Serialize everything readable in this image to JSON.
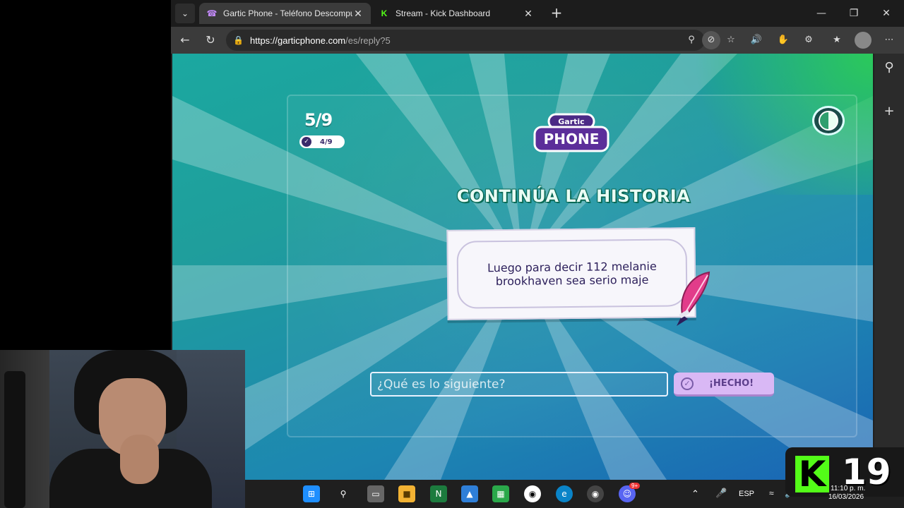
{
  "browser": {
    "tabs": [
      {
        "title": "Gartic Phone - Teléfono Descompu",
        "active": true,
        "favicon": "telephone-icon"
      },
      {
        "title": "Stream - Kick Dashboard",
        "active": false,
        "favicon": "kick-icon"
      }
    ],
    "url_host": "https://garticphone.com",
    "url_path": "/es/reply?5"
  },
  "game": {
    "round": "5/9",
    "done_count": "4/9",
    "logo_top": "Gartic",
    "logo_bottom": "PHONE",
    "heading": "CONTINÚA LA HISTORIA",
    "story_text": "Luego para decir 112 melanie brookhaven sea serio maje",
    "input_placeholder": "¿Qué es lo siguiente?",
    "done_button": "¡HECHO!"
  },
  "taskbar": {
    "language": "ESP",
    "time": "11:10 p. m.",
    "date": "16/03/2026",
    "discord_badge": "9+"
  },
  "kick_overlay": {
    "letter": "K",
    "count": "19"
  },
  "colors": {
    "accent_green": "#53fc18",
    "button_purple": "#d9b8f5",
    "text_dark_purple": "#2b1e5a"
  }
}
